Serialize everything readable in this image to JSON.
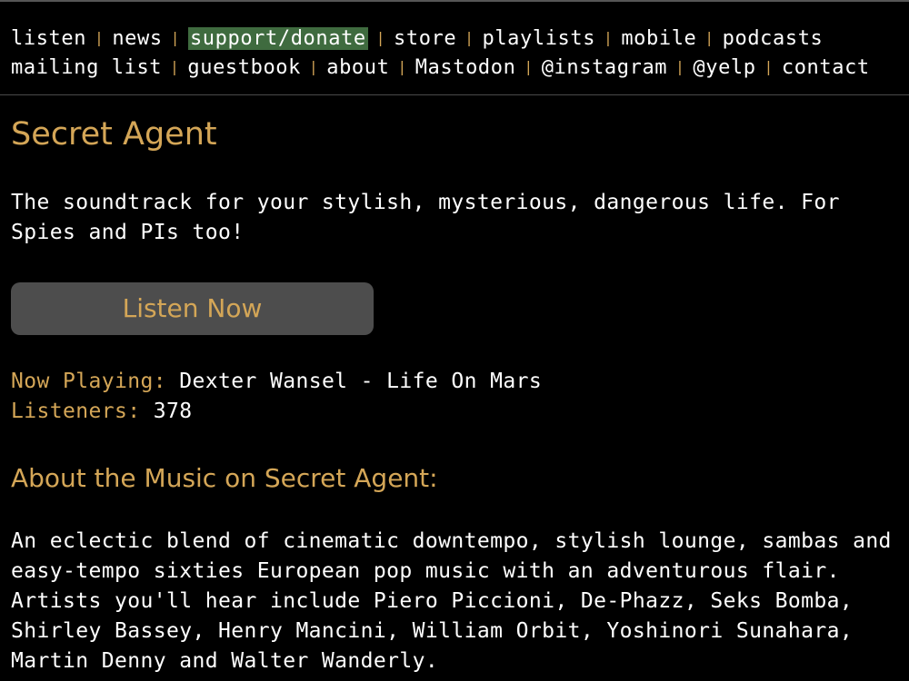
{
  "nav": {
    "row1": [
      "listen",
      "news",
      "support/donate",
      "store",
      "playlists",
      "mobile",
      "podcasts"
    ],
    "row2": [
      "mailing list",
      "guestbook",
      "about",
      "Mastodon",
      "@instagram",
      "@yelp",
      "contact"
    ],
    "separator": "|",
    "highlighted": "support/donate"
  },
  "station": {
    "title": "Secret Agent",
    "description": "The soundtrack for your stylish, mysterious, dangerous life. For Spies and PIs too!",
    "listen_button": "Listen Now",
    "now_playing_label": "Now Playing:",
    "now_playing_value": "Dexter Wansel - Life On Mars",
    "listeners_label": "Listeners:",
    "listeners_value": "378"
  },
  "about": {
    "heading": "About the Music on Secret Agent:",
    "text": "An eclectic blend of cinematic downtempo, stylish lounge, sambas and easy-tempo sixties European pop music with an adventurous flair. Artists you'll hear include Piero Piccioni, De-Phazz, Seks Bomba, Shirley Bassey, Henry Mancini, William Orbit, Yoshinori Sunahara, Martin Denny and Walter Wanderly."
  },
  "colors": {
    "background": "#000000",
    "accent": "#d4a657",
    "text": "#ffffff",
    "button_bg": "#4d4d4d",
    "highlight_bg": "#3f6b3f"
  }
}
